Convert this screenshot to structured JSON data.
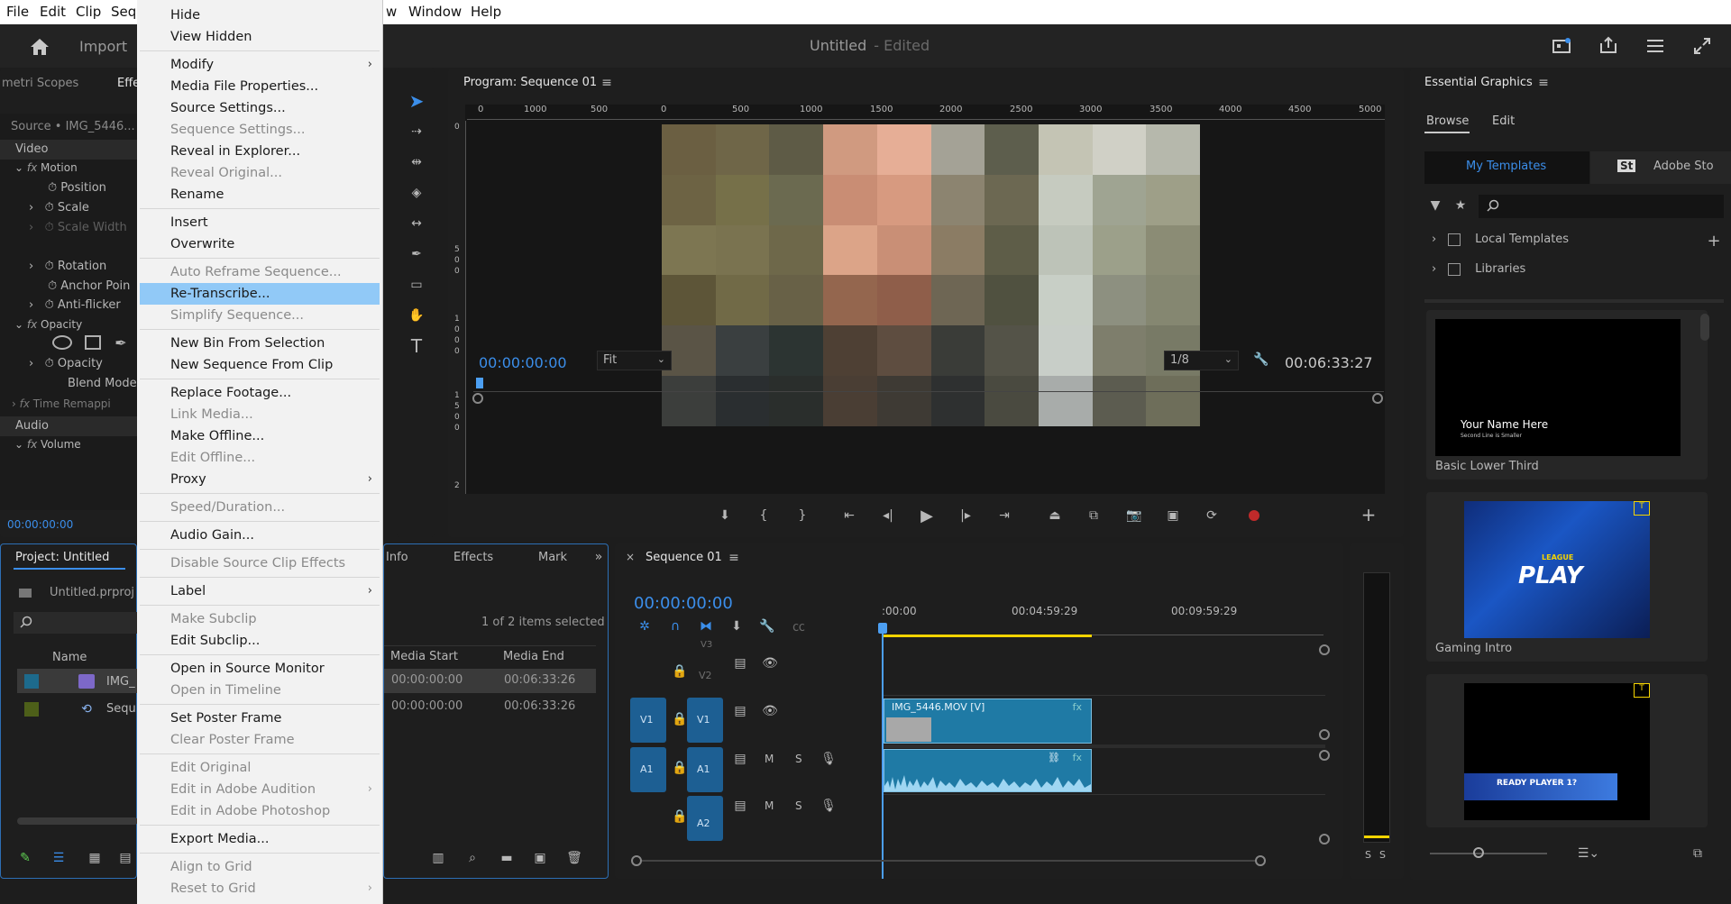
{
  "menubar": {
    "items": [
      "File",
      "Edit",
      "Clip",
      "Sequ",
      "w",
      "Window",
      "Help"
    ]
  },
  "titlebar": {
    "home_label": "Import",
    "title": "Untitled",
    "edited": "- Edited"
  },
  "left_panel": {
    "tabs": [
      "metri Scopes",
      "Effe"
    ],
    "source": "Source • IMG_5446...",
    "video_label": "Video",
    "motion": "Motion",
    "position": "Position",
    "scale": "Scale",
    "scale_width": "Scale Width",
    "rotation": "Rotation",
    "anchor": "Anchor Poin",
    "anti_flicker": "Anti-flicker",
    "opacity": "Opacity",
    "opacity2": "Opacity",
    "blend": "Blend Mode",
    "time_remap": "Time Remappi",
    "audio_label": "Audio",
    "volume": "Volume",
    "timecode": "00:00:00:00"
  },
  "project_panel": {
    "tab": "Project: Untitled",
    "file": "Untitled.prproj",
    "col_name": "Name",
    "row1": "IMG_",
    "row2": "Sequ"
  },
  "info_panel": {
    "tabs": [
      "Info",
      "Effects",
      "Mark"
    ],
    "selected": "1 of 2 items selected",
    "col_start": "Media Start",
    "col_end": "Media End",
    "rows": [
      {
        "start": "00:00:00:00",
        "end": "00:06:33:26"
      },
      {
        "start": "00:00:00:00",
        "end": "00:06:33:26"
      }
    ]
  },
  "program_monitor": {
    "tab": "Program: Sequence 01",
    "ruler": [
      "0",
      "1000",
      "500",
      "0",
      "500",
      "1000",
      "1500",
      "2000",
      "2500",
      "3000",
      "3500",
      "4000",
      "4500",
      "5000"
    ],
    "vruler": [
      "0",
      "5",
      "0",
      "0",
      "1",
      "0",
      "0",
      "0",
      "1",
      "5",
      "0",
      "0",
      "2"
    ],
    "timecode": "00:00:00:00",
    "fit": "Fit",
    "resolution": "1/8",
    "duration": "00:06:33:27"
  },
  "timeline": {
    "tab": "Sequence 01",
    "timecode": "00:00:00:00",
    "ticks": [
      ":00:00",
      "00:04:59:29",
      "00:09:59:29"
    ],
    "tracks": {
      "v3": "V3",
      "v2": "V2",
      "v1": "V1",
      "a1": "A1",
      "a2": "A2"
    },
    "clip_video": "IMG_5446.MOV [V]",
    "m": "M",
    "s": "S"
  },
  "essential_graphics": {
    "tab": "Essential Graphics",
    "subtabs": [
      "Browse",
      "Edit"
    ],
    "my_templates": "My Templates",
    "adobe_stock": "Adobe Sto",
    "st": "St",
    "local_templates": "Local Templates",
    "libraries": "Libraries",
    "templates": [
      {
        "name": "Basic Lower Third",
        "line1": "Your Name Here",
        "line2": "Second Line is Smaller"
      },
      {
        "name": "Gaming Intro",
        "line1": "LEAGUE",
        "line2": "PLAY"
      },
      {
        "name": "",
        "line1": "READY PLAYER 1?",
        "line2": ""
      }
    ]
  },
  "context_menu": {
    "items": [
      {
        "label": "Hide"
      },
      {
        "label": "View Hidden"
      },
      {
        "label": "Modify"
      },
      {
        "label": "Media File Properties..."
      },
      {
        "label": "Source Settings..."
      },
      {
        "label": "Sequence Settings..."
      },
      {
        "label": "Reveal in Explorer..."
      },
      {
        "label": "Reveal Original..."
      },
      {
        "label": "Rename"
      },
      {
        "label": "Insert"
      },
      {
        "label": "Overwrite"
      },
      {
        "label": "Auto Reframe Sequence..."
      },
      {
        "label": "Re-Transcribe..."
      },
      {
        "label": "Simplify Sequence..."
      },
      {
        "label": "New Bin From Selection"
      },
      {
        "label": "New Sequence From Clip"
      },
      {
        "label": "Replace Footage..."
      },
      {
        "label": "Link Media..."
      },
      {
        "label": "Make Offline..."
      },
      {
        "label": "Edit Offline..."
      },
      {
        "label": "Proxy"
      },
      {
        "label": "Speed/Duration..."
      },
      {
        "label": "Audio Gain..."
      },
      {
        "label": "Disable Source Clip Effects"
      },
      {
        "label": "Label"
      },
      {
        "label": "Make Subclip"
      },
      {
        "label": "Edit Subclip..."
      },
      {
        "label": "Open in Source Monitor"
      },
      {
        "label": "Open in Timeline"
      },
      {
        "label": "Set Poster Frame"
      },
      {
        "label": "Clear Poster Frame"
      },
      {
        "label": "Edit Original"
      },
      {
        "label": "Edit in Adobe Audition"
      },
      {
        "label": "Edit in Adobe Photoshop"
      },
      {
        "label": "Export Media..."
      },
      {
        "label": "Align to Grid"
      },
      {
        "label": "Reset to Grid"
      }
    ],
    "arrow": "›"
  },
  "colors": {
    "accent": "#3b8eea",
    "menu_highlight": "#91c9f7",
    "clip": "#1f7aa5",
    "playhead": "#4c9ff2",
    "yellow": "#f5d400"
  }
}
